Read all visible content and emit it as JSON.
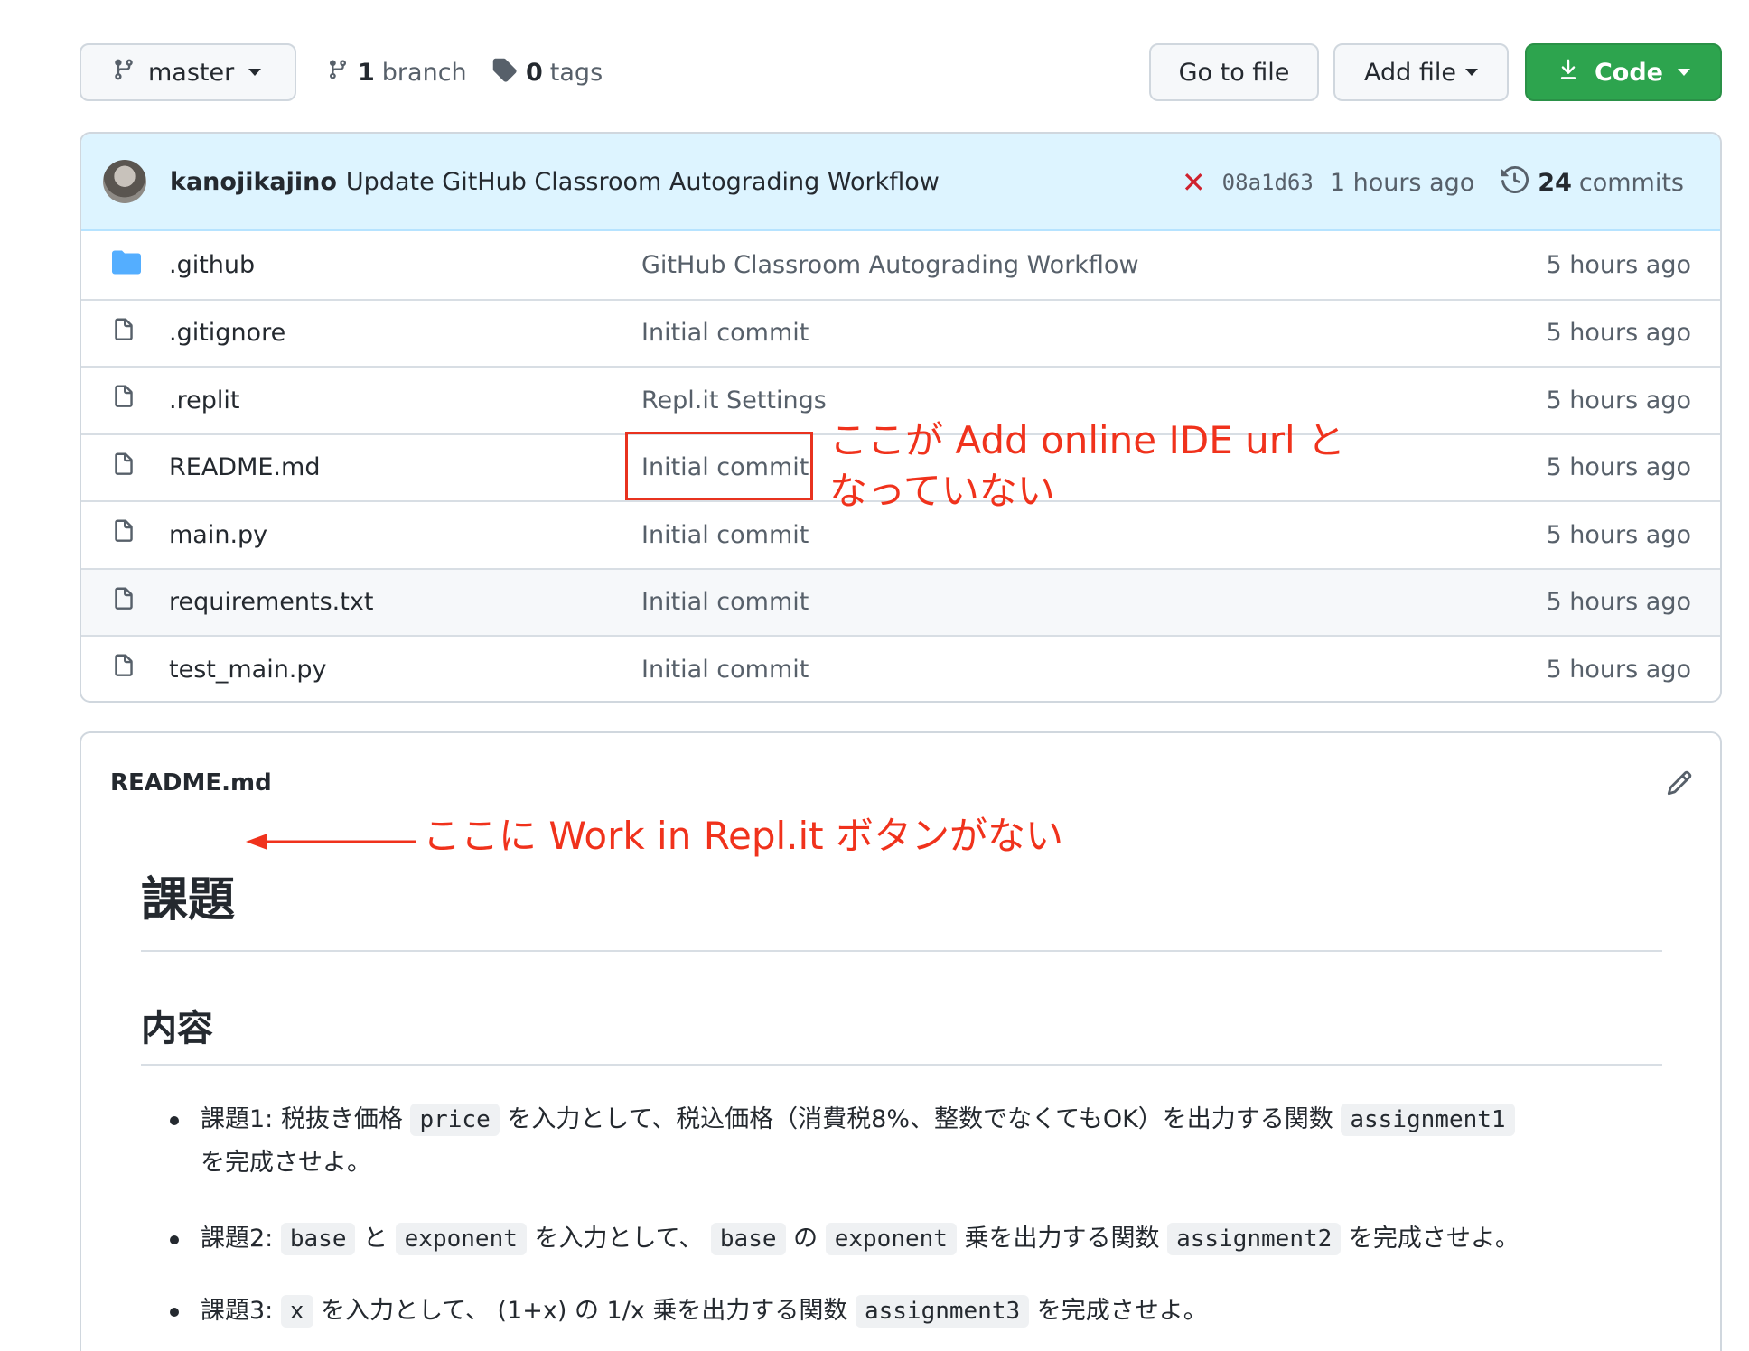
{
  "toolbar": {
    "branch_name": "master",
    "branch_count": "1",
    "branch_label": "branch",
    "tag_count": "0",
    "tag_label": "tags",
    "goto_label": "Go to file",
    "add_file_label": "Add file",
    "code_label": "Code",
    "code_color": "#2da44e"
  },
  "commit": {
    "author": "kanojikajino",
    "message": "Update GitHub Classroom Autograding Workflow",
    "status": "✕",
    "sha": "08a1d63",
    "time": "1 hours ago",
    "commit_count": "24",
    "commit_label": "commits"
  },
  "files": [
    {
      "name": ".github",
      "type": "folder",
      "message": "GitHub Classroom Autograding Workflow",
      "age": "5 hours ago"
    },
    {
      "name": ".gitignore",
      "type": "file",
      "message": "Initial commit",
      "age": "5 hours ago"
    },
    {
      "name": ".replit",
      "type": "file",
      "message": "Repl.it Settings",
      "age": "5 hours ago"
    },
    {
      "name": "README.md",
      "type": "file",
      "message": "Initial commit",
      "age": "5 hours ago"
    },
    {
      "name": "main.py",
      "type": "file",
      "message": "Initial commit",
      "age": "5 hours ago"
    },
    {
      "name": "requirements.txt",
      "type": "file",
      "message": "Initial commit",
      "age": "5 hours ago"
    },
    {
      "name": "test_main.py",
      "type": "file",
      "message": "Initial commit",
      "age": "5 hours ago"
    }
  ],
  "annotations": {
    "commit_note_line1": "ここが Add online IDE url と",
    "commit_note_line2": "なっていない",
    "readme_note": "ここに Work in Repl.it ボタンがない",
    "color": "#f0321c"
  },
  "readme": {
    "filename": "README.md",
    "h1": "課題",
    "h2": "内容",
    "items": [
      {
        "a": "課題1: 税抜き価格 ",
        "code1": "price",
        "b": " を入力として、税込価格（消費税8%、整数でなくてもOK）を出力する関数 ",
        "code2": "assignment1",
        "c": "を完成させよ。"
      },
      {
        "a": "課題2: ",
        "code1": "base",
        "b": " と ",
        "code2": "exponent",
        "c": " を入力として、 ",
        "code3": "base",
        "d": " の ",
        "code4": "exponent",
        "e": " 乗を出力する関数 ",
        "code5": "assignment2",
        "f": " を完成させよ。"
      },
      {
        "a": "課題3: ",
        "code1": "x",
        "b": " を入力として、 (1+x) の 1/x 乗を出力する関数 ",
        "code2": "assignment3",
        "c": " を完成させよ。"
      }
    ]
  }
}
